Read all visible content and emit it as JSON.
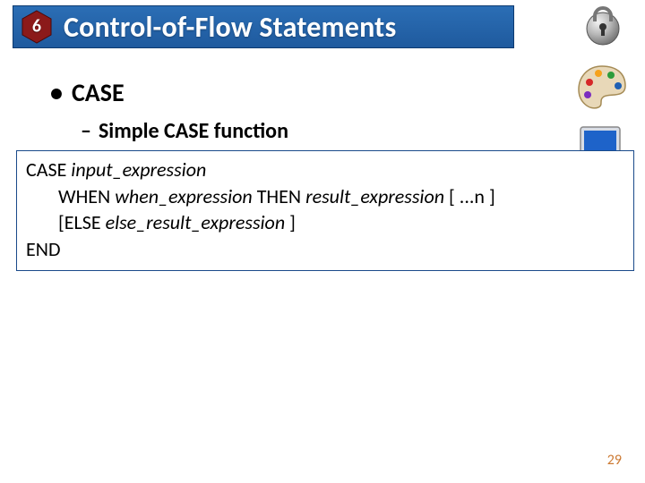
{
  "header": {
    "chapter_number": "6",
    "title": "Control-of-Flow Statements"
  },
  "content": {
    "bullet_main": "CASE",
    "bullet_sub": "Simple CASE function",
    "code": {
      "l1_kw": "CASE ",
      "l1_it": "input_expression",
      "l2_kw1": "WHEN ",
      "l2_it1": "when_expression",
      "l2_kw2": " THEN ",
      "l2_it2": "result_expression",
      "l2_tail": " [ ...n ]",
      "l3_kw1": "[ELSE ",
      "l3_it1": "else_result_expression",
      "l3_tail": " ]",
      "l4": "END"
    }
  },
  "footer": {
    "page_number": "29"
  },
  "icons": {
    "lock": "lock-icon",
    "palette": "palette-icon",
    "monitor": "monitor-icon"
  }
}
